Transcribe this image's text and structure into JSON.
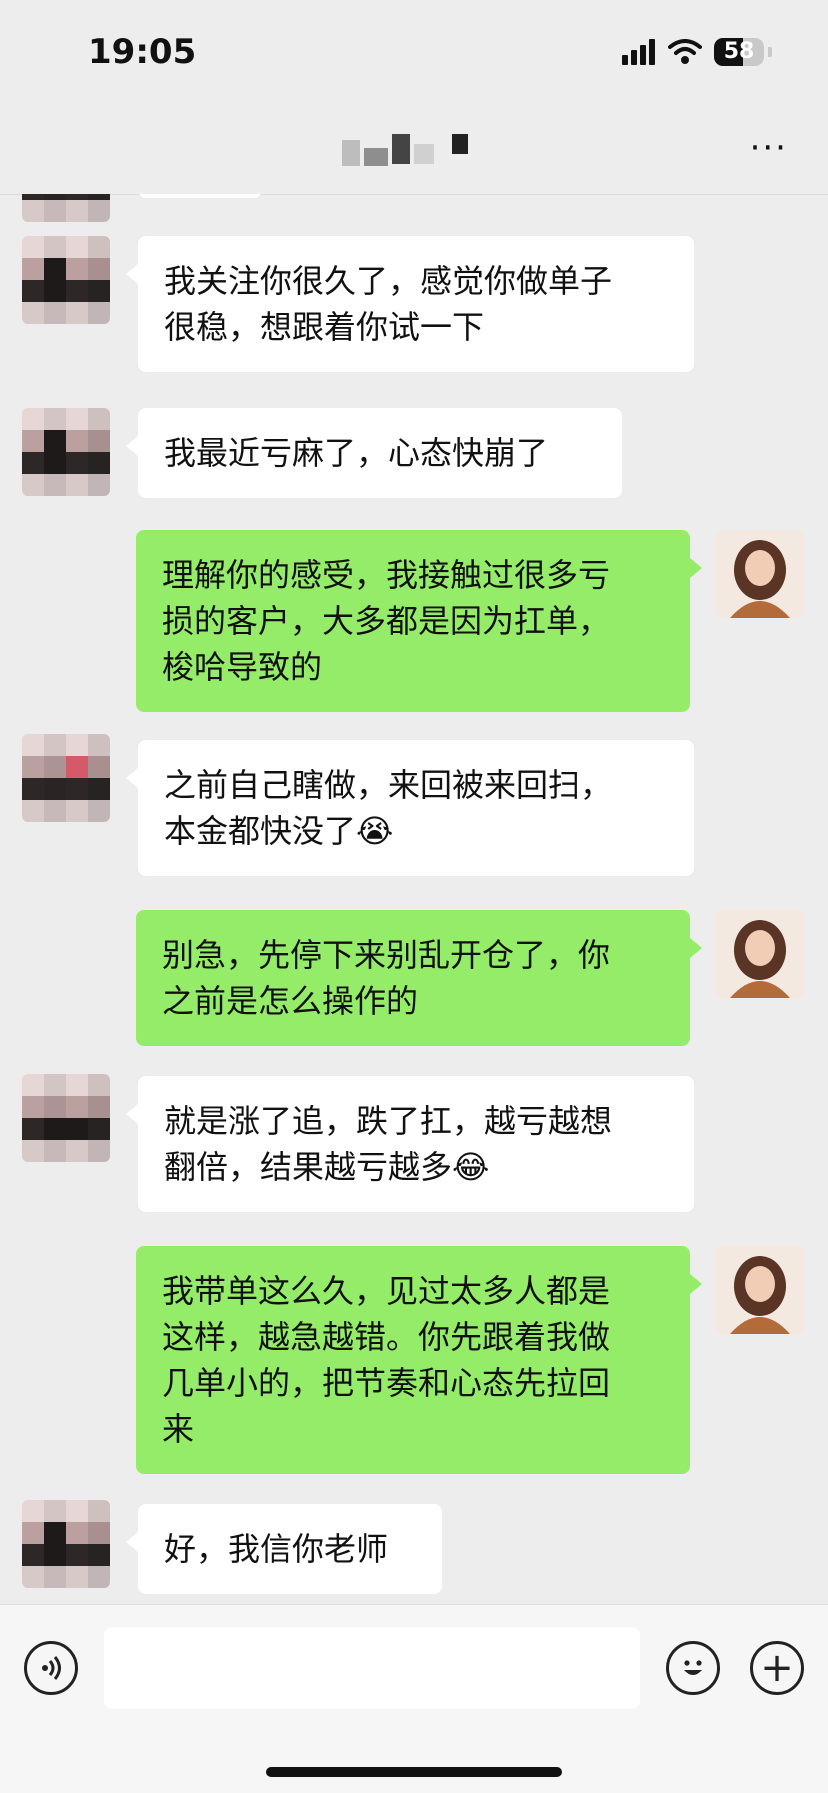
{
  "status_bar": {
    "time": "19:05",
    "battery": "58",
    "battery_level": 0.58
  },
  "header": {
    "more_label": "···"
  },
  "messages": [
    {
      "side": "left",
      "text": "我关注你很久了，感觉你做单子\n很稳，想跟着你试一下"
    },
    {
      "side": "left",
      "text": "我最近亏麻了，心态快崩了"
    },
    {
      "side": "right",
      "text": "理解你的感受，我接触过很多亏\n损的客户，大多都是因为扛单，\n梭哈导致的"
    },
    {
      "side": "left",
      "text": "之前自己瞎做，来回被来回扫，\n本金都快没了😭"
    },
    {
      "side": "right",
      "text": "别急，先停下来别乱开仓了，你\n之前是怎么操作的"
    },
    {
      "side": "left",
      "text": "就是涨了追，跌了扛，越亏越想\n翻倍，结果越亏越多😂"
    },
    {
      "side": "right",
      "text": "我带单这么久，见过太多人都是\n这样，越急越错。你先跟着我做\n几单小的，把节奏和心态先拉回\n来"
    },
    {
      "side": "left",
      "text": "好，我信你老师"
    }
  ],
  "input_bar": {
    "voice_icon": "voice-icon",
    "emoji_icon": "emoji-icon",
    "plus_icon": "plus-icon",
    "plus_label": "+"
  }
}
